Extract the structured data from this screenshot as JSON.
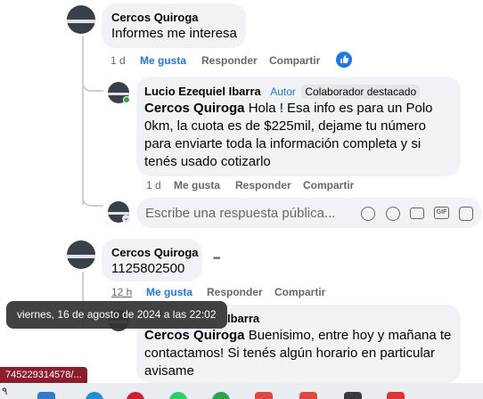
{
  "comments": [
    {
      "author": "Cercos Quiroga",
      "text": "Informes me interesa",
      "time": "1 d",
      "like": "Me gusta",
      "reply": "Responder",
      "share": "Compartir",
      "reaction_icon": "like-reaction-icon"
    },
    {
      "author": "Lucio Ezequiel Ibarra",
      "role": "Autor",
      "badge": "Colaborador destacado",
      "mention": "Cercos Quiroga",
      "text_lines": [
        "Hola ! Esa info es para un Polo",
        "0km, la cuota es de $225mil, dejame tu número",
        "para enviarte toda la información completa y si",
        "tenés usado cotizarlo"
      ],
      "time": "1 d",
      "like": "Me gusta",
      "reply": "Responder",
      "share": "Compartir"
    },
    {
      "author": "Cercos Quiroga",
      "text": "1125802500",
      "time": "12 h",
      "like": "Me gusta",
      "reply": "Responder",
      "share": "Compartir",
      "more": "•••"
    },
    {
      "author_partial": "Ibarra",
      "mention": "Cercos Quiroga",
      "text_lines": [
        "Buenisimo, entre hoy y mañana te",
        "contactamos! Si tenés algún horario en particular",
        "avisame"
      ]
    }
  ],
  "reply_input": {
    "placeholder": "Escribe una respuesta pública..."
  },
  "reply_icons": [
    "avatar-icon",
    "sticker-icon",
    "emoji-icon",
    "camera-icon",
    "gif-icon",
    "sticker-pack-icon"
  ],
  "tooltip": "viernes, 16 de agosto de 2024 a las 22:02",
  "status_url": "745229314578/...",
  "taskbar_left_char": "٩",
  "colors": {
    "link_blue": "#1877f2",
    "bubble_bg": "#f0f2f5",
    "muted": "#65676b"
  }
}
